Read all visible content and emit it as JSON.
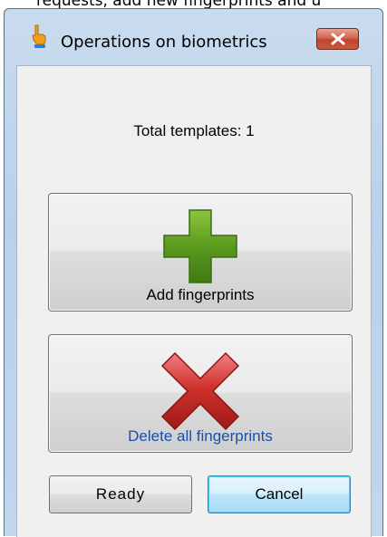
{
  "window": {
    "title": "Operations on biometrics",
    "partial_text_above": "requests, add new fingerprints and u"
  },
  "total_templates": "Total templates: 1",
  "buttons": {
    "add_fingerprints": "Add fingerprints",
    "delete_all": "Delete all fingerprints",
    "ready": "Ready",
    "cancel": "Cancel"
  },
  "icons": {
    "app": "hand-pointer-icon",
    "close": "close-icon",
    "add": "green-plus-icon",
    "delete": "red-x-icon"
  },
  "colors": {
    "close_button": "#c8482f",
    "add_icon": "#5a9a1e",
    "delete_icon": "#d0312d",
    "delete_label": "#1a4fa8"
  }
}
